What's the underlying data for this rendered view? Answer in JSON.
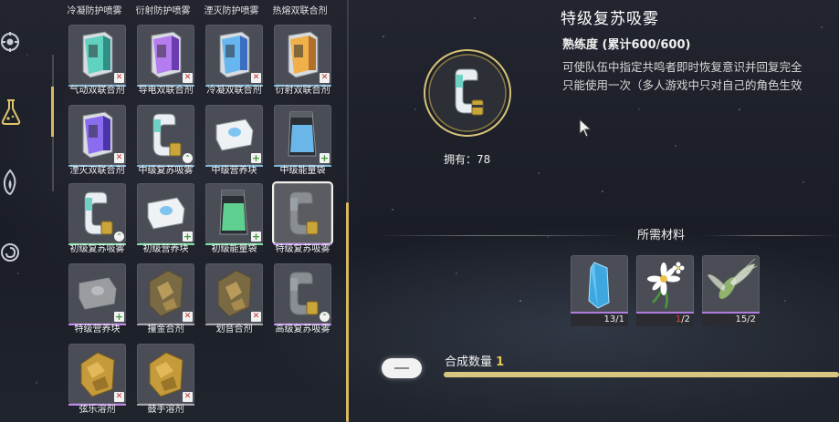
{
  "colors": {
    "accent_gold": "#d9b860",
    "strip_blue": "#7fb7d8",
    "strip_green": "#7fe3a8",
    "strip_purple": "#c48bf0",
    "strip_gray": "#a8aab0"
  },
  "left_nav": {
    "items": [
      {
        "icon": "echo-emblem-icon"
      },
      {
        "icon": "flask-icon"
      },
      {
        "icon": "flame-emblem-icon"
      },
      {
        "icon": "spiral-emblem-icon"
      }
    ]
  },
  "grid": {
    "top_row_labels": [
      "冷凝防护喷雾",
      "衍射防护喷雾",
      "湮灭防护喷雾",
      "热熔双联合剂"
    ],
    "items": [
      {
        "name": "气动双联合剂",
        "badge": "x",
        "strip": "strip_blue",
        "icon": "canister-teal-icon"
      },
      {
        "name": "导电双联合剂",
        "badge": "x",
        "strip": "strip_blue",
        "icon": "canister-purple-icon"
      },
      {
        "name": "冷凝双联合剂",
        "badge": "x",
        "strip": "strip_blue",
        "icon": "canister-blue-icon"
      },
      {
        "name": "衍射双联合剂",
        "badge": "x",
        "strip": "strip_blue",
        "icon": "canister-orange-icon"
      },
      {
        "name": "湮灭双联合剂",
        "badge": "x",
        "strip": "strip_blue",
        "icon": "canister-violet-icon"
      },
      {
        "name": "中级复苏吸雾",
        "badge": "up",
        "strip": "strip_blue",
        "icon": "inhaler-icon"
      },
      {
        "name": "中级营养块",
        "badge": "plus",
        "strip": "strip_blue",
        "icon": "nutrient-block-icon"
      },
      {
        "name": "中级能量袋",
        "badge": "plus",
        "strip": "strip_blue",
        "icon": "energy-bag-blue-icon"
      },
      {
        "name": "初级复苏吸雾",
        "badge": "up",
        "strip": "strip_green",
        "icon": "inhaler-icon"
      },
      {
        "name": "初级营养块",
        "badge": "plus",
        "strip": "strip_green",
        "icon": "nutrient-block-icon"
      },
      {
        "name": "初级能量袋",
        "badge": "plus",
        "strip": "strip_green",
        "icon": "energy-bag-green-icon"
      },
      {
        "name": "特级复苏吸雾",
        "badge": "",
        "strip": "strip_purple",
        "icon": "inhaler-gray-icon",
        "selected": true
      },
      {
        "name": "特级营养块",
        "badge": "plus",
        "strip": "strip_purple",
        "icon": "nutrient-block-gray-icon"
      },
      {
        "name": "撞金合剂",
        "badge": "x",
        "strip": "strip_gray",
        "icon": "brass-ore-icon"
      },
      {
        "name": "划音合剂",
        "badge": "x",
        "strip": "strip_gray",
        "icon": "brass-ore-icon"
      },
      {
        "name": "高级复苏吸雾",
        "badge": "up",
        "strip": "strip_purple",
        "icon": "inhaler-gray-icon"
      },
      {
        "name": "弦乐溶剂",
        "badge": "x",
        "strip": "strip_purple",
        "icon": "gold-ore-icon"
      },
      {
        "name": "鼓手溶剂",
        "badge": "x",
        "strip": "strip_gray",
        "icon": "gold-ore-icon"
      }
    ]
  },
  "detail": {
    "title": "特级复苏吸雾",
    "mastery_label": "熟练度",
    "mastery_value": "(累计600/600)",
    "description_line1": "可使队伍中指定共鸣者即时恢复意识并回复完全",
    "description_line2": "只能使用一次（多人游戏中只对自己的角色生效",
    "owned_label": "拥有：",
    "owned_count": "78"
  },
  "materials": {
    "title": "所需材料",
    "items": [
      {
        "icon": "blue-crystal-icon",
        "have": "13",
        "need": "1",
        "enough": true
      },
      {
        "icon": "white-flower-icon",
        "have": "1",
        "need": "2",
        "enough": false
      },
      {
        "icon": "cicada-wing-icon",
        "have": "15",
        "need": "2",
        "enough": true
      }
    ]
  },
  "craft": {
    "quantity_label": "合成数量",
    "quantity_value": "1"
  }
}
